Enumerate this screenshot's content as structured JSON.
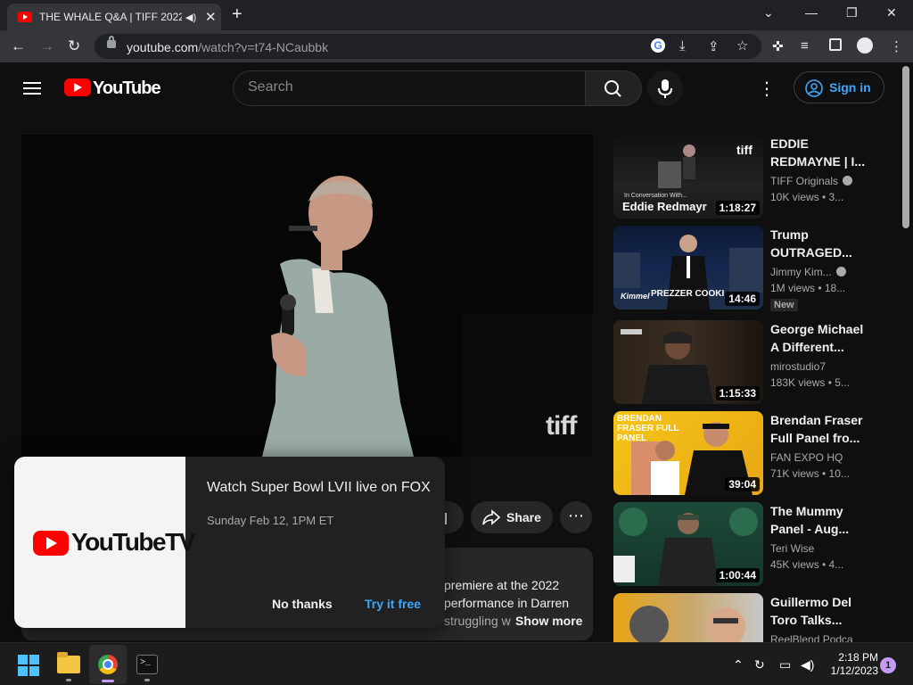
{
  "browser": {
    "tab_title": "THE WHALE Q&A | TIFF 2022",
    "url_host": "youtube.com",
    "url_path": "/watch?v=t74-NCaubbk",
    "new_tab_label": "+"
  },
  "youtube": {
    "logo_text": "YouTube",
    "search_placeholder": "Search",
    "signin_label": "Sign in"
  },
  "player": {
    "watermark": "tiff"
  },
  "actions": {
    "share_label": "Share"
  },
  "description": {
    "line1": "premiere at the 2022",
    "line2": "performance in Darren",
    "line3": "struggling w",
    "show_more": "Show more"
  },
  "promo": {
    "logo_text": "YouTubeTV",
    "headline": "Watch Super Bowl LVII live on FOX",
    "subtext": "Sunday Feb 12, 1PM ET",
    "no_thanks": "No thanks",
    "try_free": "Try it free"
  },
  "recommendations": [
    {
      "title": "EDDIE REDMAYNE | I...",
      "channel": "TIFF Originals",
      "verified": true,
      "meta": "10K views  • 3...",
      "duration": "1:18:27",
      "overlay": "Eddie Redmayr",
      "badge": ""
    },
    {
      "title": "Trump OUTRAGED...",
      "channel": "Jimmy Kim...",
      "verified": true,
      "meta": "1M views  • 18...",
      "duration": "14:46",
      "overlay": "PREZZER COOKI",
      "badge": "New"
    },
    {
      "title": "George Michael A Different...",
      "channel": "mirostudio7",
      "verified": false,
      "meta": "183K views  • 5...",
      "duration": "1:15:33",
      "overlay": "",
      "badge": ""
    },
    {
      "title": "Brendan Fraser Full Panel fro...",
      "channel": "FAN EXPO HQ",
      "verified": false,
      "meta": "71K views  • 10...",
      "duration": "39:04",
      "overlay": "BRENDAN FRASER FULL PANEL",
      "badge": ""
    },
    {
      "title": "The Mummy Panel - Aug...",
      "channel": "Teri Wise",
      "verified": false,
      "meta": "45K views  • 4...",
      "duration": "1:00:44",
      "overlay": "",
      "badge": ""
    },
    {
      "title": "Guillermo Del Toro Talks...",
      "channel": "ReelBlend Podca",
      "verified": false,
      "meta": "",
      "duration": "",
      "overlay": "",
      "badge": ""
    }
  ],
  "taskbar": {
    "time": "2:18 PM",
    "date": "1/12/2023",
    "notification_count": "1"
  },
  "colors": {
    "youtube_red": "#ff0000",
    "link_blue": "#3ea6ff",
    "page_bg": "#0f0f0f"
  }
}
